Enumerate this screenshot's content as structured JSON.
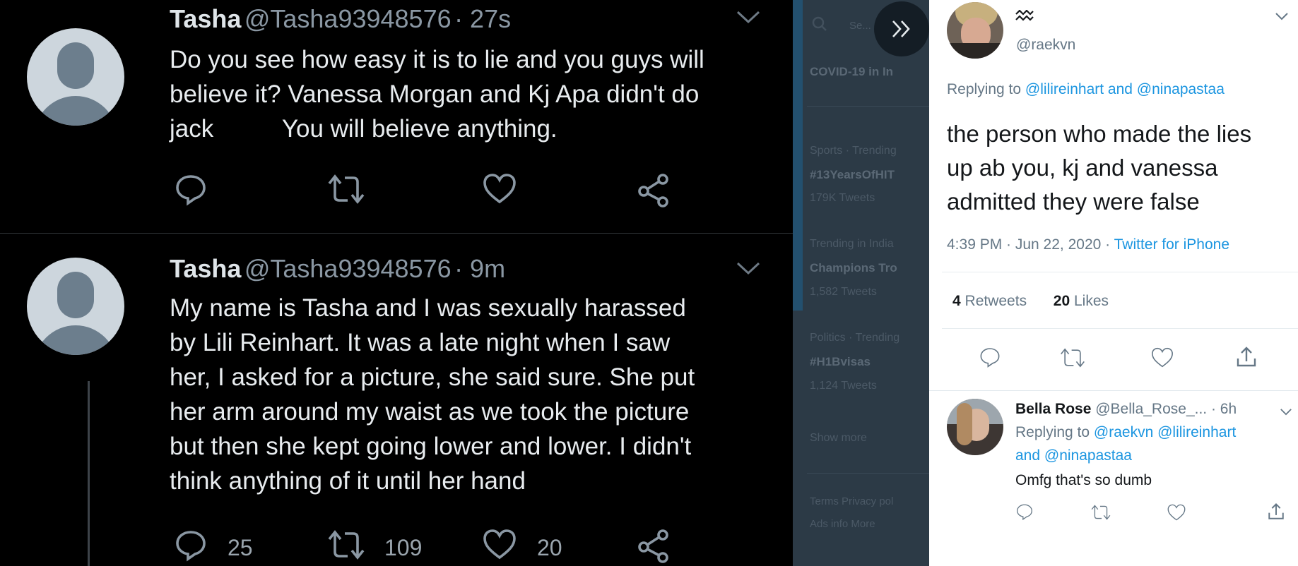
{
  "timeline": {
    "tweets": [
      {
        "name": "Tasha",
        "handle": "@Tasha93948576",
        "time": "· 27s",
        "lines": [
          "Do you see how easy it is to lie and you guys will",
          "believe it? Vanessa Morgan and Kj Apa didn't do",
          "jack          You will believe anything."
        ],
        "reply_count": "",
        "retweet_count": "",
        "like_count": ""
      },
      {
        "name": "Tasha",
        "handle": "@Tasha93948576",
        "time": "· 9m",
        "lines": [
          "My name is Tasha and I was sexually harassed",
          "by Lili Reinhart. It was a late night when I saw",
          "her, I asked for a picture, she said sure. She put",
          "her arm around my waist as we took the picture",
          "but then she kept going lower and lower. I didn't",
          "think anything of it until her hand"
        ],
        "reply_count": "25",
        "retweet_count": "109",
        "like_count": "20"
      }
    ]
  },
  "sidebar": {
    "search_placeholder": "Se...",
    "expand_icon": "double-chevron-right-icon",
    "trends": [
      {
        "context": "",
        "name": "COVID-19 in In",
        "count": ""
      },
      {
        "context": "Sports · Trending",
        "name": "#13YearsOfHIT",
        "count": "179K Tweets"
      },
      {
        "context": "Trending in India",
        "name": "Champions Tro",
        "count": "1,582 Tweets"
      },
      {
        "context": "Politics · Trending",
        "name": "#H1Bvisas",
        "count": "1,124 Tweets"
      }
    ],
    "show_more": "Show more",
    "footer": [
      "Terms Privacy pol",
      "Ads info More"
    ]
  },
  "detail": {
    "author_name_icon": "aquarius-icon",
    "author_name": "♒",
    "author_handle": "@raekvn",
    "replying_prefix": "Replying to",
    "replying_to": "@lilireinhart and @ninapastaa",
    "text_lines": [
      "the person who made the lies",
      "up ab you, kj and vanessa",
      "admitted they were false"
    ],
    "timestamp": "4:39 PM · Jun 22, 2020 ·",
    "source": "Twitter for iPhone",
    "retweets_count": "4",
    "retweets_label": "Retweets",
    "likes_count": "20",
    "likes_label": "Likes"
  },
  "reply": {
    "name": "Bella Rose",
    "handle_time": "@Bella_Rose_... · 6h",
    "replying_prefix": "Replying to",
    "replying_line1": "@raekvn @lilireinhart",
    "replying_line2_prefix": "and",
    "replying_line2_handle": "@ninapastaa",
    "text": "Omfg that's so dumb"
  },
  "colors": {
    "dark_bg": "#000000",
    "dark_text": "#e8ecef",
    "dark_muted": "#8a97a3",
    "link_blue": "#1b95e0",
    "light_bg": "#ffffff",
    "dim_overlay": "#2c3a46"
  }
}
